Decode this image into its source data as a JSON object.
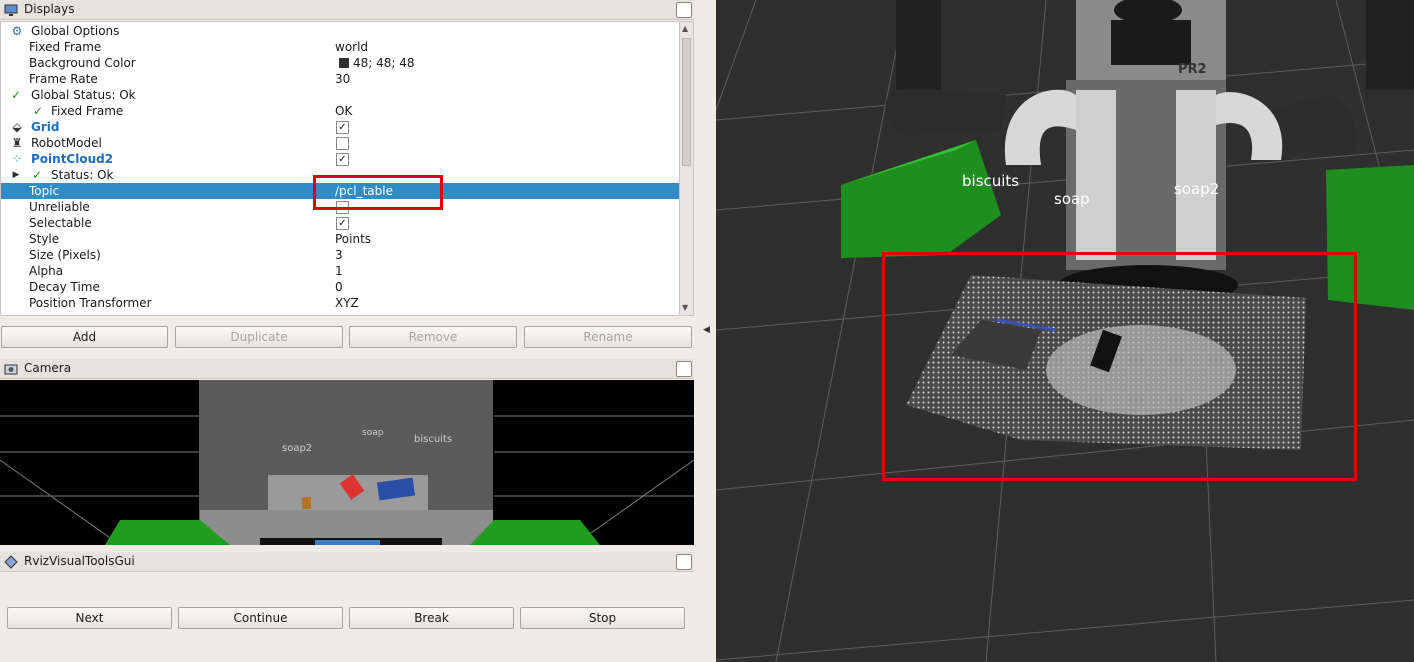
{
  "displays_panel": {
    "title": "Displays",
    "tree": [
      {
        "label": "Global Options",
        "value": ""
      },
      {
        "label": "Fixed Frame",
        "value": "world"
      },
      {
        "label": "Background Color",
        "value": "48; 48; 48"
      },
      {
        "label": "Frame Rate",
        "value": "30"
      },
      {
        "label": "Global Status: Ok",
        "value": ""
      },
      {
        "label": "Fixed Frame",
        "value": "OK"
      },
      {
        "label": "Grid",
        "value": ""
      },
      {
        "label": "RobotModel",
        "value": ""
      },
      {
        "label": "PointCloud2",
        "value": ""
      },
      {
        "label": "Status: Ok",
        "value": ""
      },
      {
        "label": "Topic",
        "value": "/pcl_table"
      },
      {
        "label": "Unreliable",
        "value": ""
      },
      {
        "label": "Selectable",
        "value": ""
      },
      {
        "label": "Style",
        "value": "Points"
      },
      {
        "label": "Size (Pixels)",
        "value": "3"
      },
      {
        "label": "Alpha",
        "value": "1"
      },
      {
        "label": "Decay Time",
        "value": "0"
      },
      {
        "label": "Position Transformer",
        "value": "XYZ"
      }
    ],
    "checkbox_marks": {
      "checked": "✓",
      "unchecked": ""
    },
    "buttons": {
      "add": "Add",
      "duplicate": "Duplicate",
      "remove": "Remove",
      "rename": "Rename"
    }
  },
  "camera_panel": {
    "title": "Camera",
    "labels": {
      "soap2": "soap2",
      "soap": "soap",
      "biscuits": "biscuits"
    }
  },
  "rviz_tools_panel": {
    "title": "RvizVisualToolsGui",
    "buttons": {
      "next": "Next",
      "continue": "Continue",
      "break": "Break",
      "stop": "Stop"
    }
  },
  "scene_view": {
    "labels": {
      "biscuits": "biscuits",
      "soap": "soap",
      "soap2": "soap2",
      "robot_tag": "PR2"
    }
  },
  "colors": {
    "background": "#303030",
    "selection": "#308cc6",
    "highlight": "#e00000",
    "green_box": "#1f9e1f"
  }
}
